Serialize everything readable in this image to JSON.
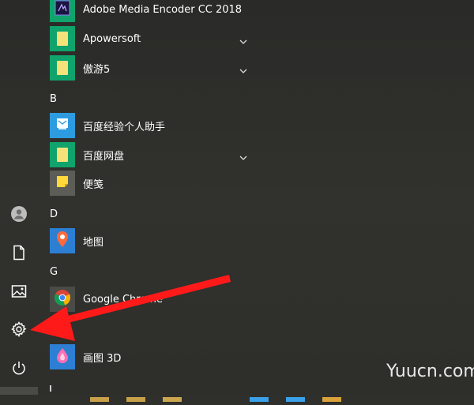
{
  "sections": {
    "b": "B",
    "d": "D",
    "g": "G"
  },
  "apps": {
    "media_encoder": "Adobe Media Encoder CC 2018",
    "apowersoft": "Apowersoft",
    "aoyou": "傲游5",
    "baidu_helper": "百度经验个人助手",
    "baidu_pan": "百度网盘",
    "notes": "便笺",
    "maps": "地图",
    "chrome": "Google Chrome",
    "paint3d": "画图 3D"
  },
  "watermark": "Yuucn.com",
  "colors": {
    "accent_green": "#10a36b",
    "tile_blue": "#2d7fd3",
    "annotation_red": "#ff1a1a"
  },
  "icons": {
    "rail": [
      "user-icon",
      "document-icon",
      "pictures-icon",
      "settings-icon",
      "power-icon"
    ]
  }
}
